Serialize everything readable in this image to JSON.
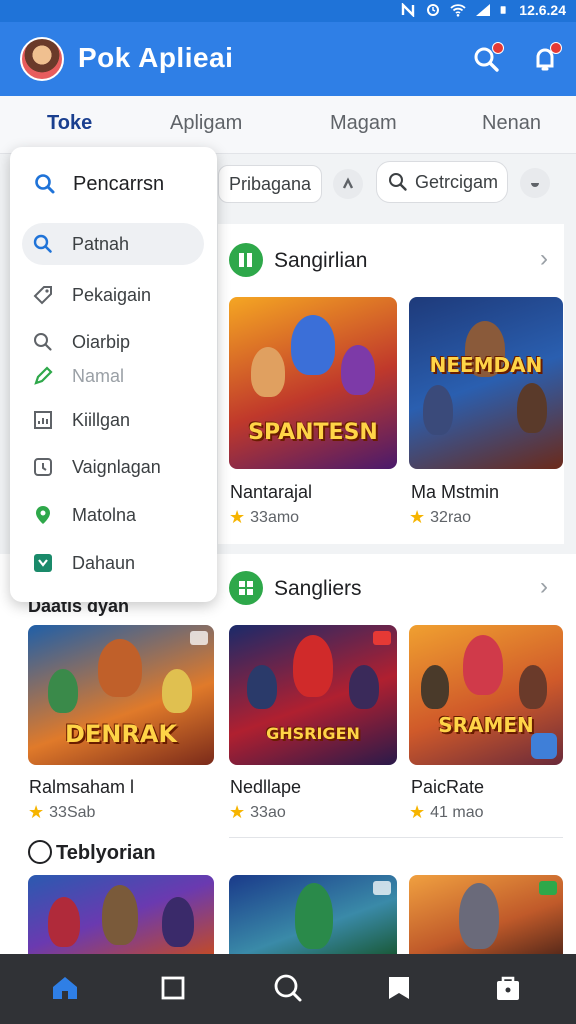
{
  "status_bar": {
    "time": "12.6.24"
  },
  "app": {
    "title": "Pok Aplieai"
  },
  "tabs": [
    {
      "label": "Toke",
      "active": true
    },
    {
      "label": "Apligam",
      "active": false
    },
    {
      "label": "Magam",
      "active": false
    },
    {
      "label": "Nenan",
      "active": false
    }
  ],
  "chips": {
    "first": "Pribagana",
    "search": "Getrcigam"
  },
  "menu": {
    "header": "Pencarrsn",
    "items": [
      {
        "label": "Patnah",
        "icon": "search-icon",
        "selected": true
      },
      {
        "label": "Pekaigain",
        "icon": "tag-icon"
      },
      {
        "label": "Oiarbip",
        "icon": "search-icon"
      },
      {
        "label": "Namal",
        "icon": "pencil-icon"
      },
      {
        "label": "Kiillgan",
        "icon": "chart-icon"
      },
      {
        "label": "Vaignlagan",
        "icon": "clock-icon"
      },
      {
        "label": "Matolna",
        "icon": "location-icon"
      },
      {
        "label": "Dahaun",
        "icon": "download-icon"
      }
    ]
  },
  "section1": {
    "title": "Sangirlian",
    "games": [
      {
        "name": "Nantarajal",
        "rating": "33amo",
        "logo": "SPANTESN"
      },
      {
        "name": "Ma Mstmin",
        "rating": "32rao",
        "logo": "NEEMDAN"
      }
    ]
  },
  "section2": {
    "title": "Sangliers",
    "side_title": "Daatis dyan",
    "games": [
      {
        "name": "Ralmsaham l",
        "rating": "33Sab",
        "logo": "DENRAK"
      },
      {
        "name": "Nedllape",
        "rating": "33ao",
        "logo": "GHSRIGEN"
      },
      {
        "name": "PaicRate",
        "rating": "41 mao",
        "logo": "SRAMEN"
      }
    ]
  },
  "section3": {
    "title": "Teblyorian"
  },
  "colors": {
    "primary": "#2f7fe6",
    "accent_green": "#2ea84a",
    "star": "#f6b400",
    "nav_bg": "#303236",
    "nav_active": "#2f7fe6"
  },
  "nav": [
    {
      "icon": "home-icon",
      "active": true
    },
    {
      "icon": "square-icon",
      "active": false
    },
    {
      "icon": "search-icon",
      "active": false
    },
    {
      "icon": "bookmark-icon",
      "active": false
    },
    {
      "icon": "bag-icon",
      "active": false
    }
  ]
}
